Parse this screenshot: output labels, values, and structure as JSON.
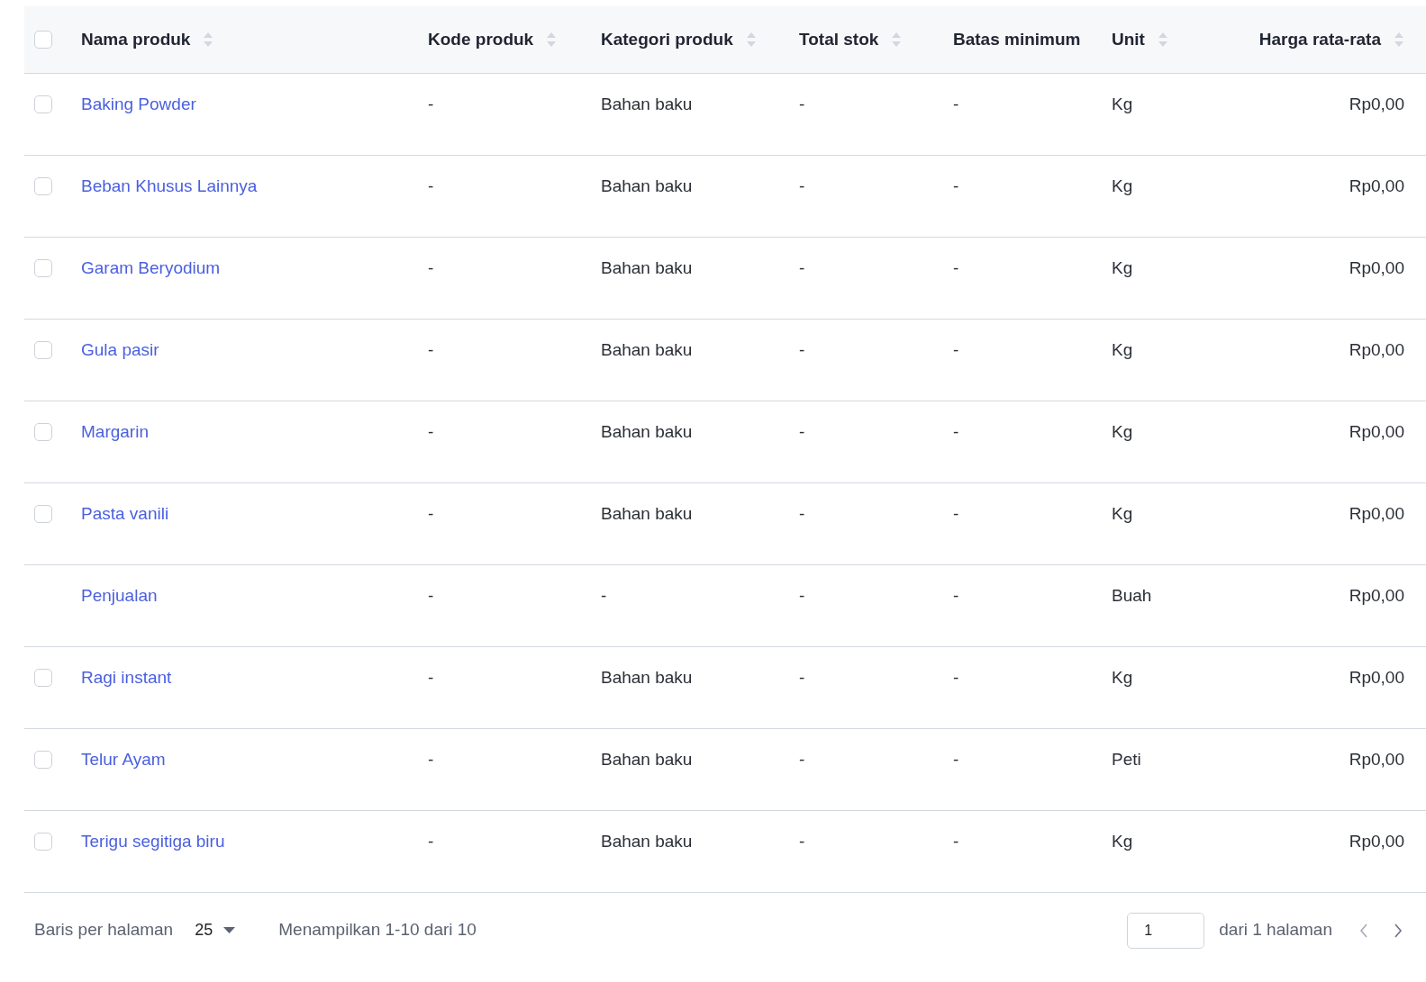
{
  "table": {
    "select_all": {
      "checked": false
    },
    "columns": [
      {
        "label": "Nama produk",
        "sortable": true
      },
      {
        "label": "Kode produk",
        "sortable": true
      },
      {
        "label": "Kategori produk",
        "sortable": true
      },
      {
        "label": "Total stok",
        "sortable": true
      },
      {
        "label": "Batas minimum",
        "sortable": false
      },
      {
        "label": "Unit",
        "sortable": true
      },
      {
        "label": "Harga rata-rata",
        "sortable": true
      }
    ],
    "rows": [
      {
        "kind": "checkbox",
        "checked": false,
        "cells": [
          "Baking Powder",
          "-",
          "Bahan baku",
          "-",
          "-",
          "Kg",
          "Rp0,00"
        ]
      },
      {
        "kind": "checkbox",
        "checked": false,
        "cells": [
          "Beban Khusus Lainnya",
          "-",
          "Bahan baku",
          "-",
          "-",
          "Kg",
          "Rp0,00"
        ]
      },
      {
        "kind": "checkbox",
        "checked": false,
        "cells": [
          "Garam Beryodium",
          "-",
          "Bahan baku",
          "-",
          "-",
          "Kg",
          "Rp0,00"
        ]
      },
      {
        "kind": "checkbox",
        "checked": false,
        "cells": [
          "Gula pasir",
          "-",
          "Bahan baku",
          "-",
          "-",
          "Kg",
          "Rp0,00"
        ]
      },
      {
        "kind": "checkbox",
        "checked": false,
        "cells": [
          "Margarin",
          "-",
          "Bahan baku",
          "-",
          "-",
          "Kg",
          "Rp0,00"
        ]
      },
      {
        "kind": "checkbox",
        "checked": false,
        "cells": [
          "Pasta vanili",
          "-",
          "Bahan baku",
          "-",
          "-",
          "Kg",
          "Rp0,00"
        ]
      },
      {
        "kind": "plain",
        "cells": [
          "Penjualan",
          "-",
          "-",
          "-",
          "-",
          "Buah",
          "Rp0,00"
        ]
      },
      {
        "kind": "checkbox",
        "checked": false,
        "cells": [
          "Ragi instant",
          "-",
          "Bahan baku",
          "-",
          "-",
          "Kg",
          "Rp0,00"
        ]
      },
      {
        "kind": "checkbox",
        "checked": false,
        "cells": [
          "Telur Ayam",
          "-",
          "Bahan baku",
          "-",
          "-",
          "Peti",
          "Rp0,00"
        ]
      },
      {
        "kind": "checkbox",
        "checked": false,
        "cells": [
          "Terigu segitiga biru",
          "-",
          "Bahan baku",
          "-",
          "-",
          "Kg",
          "Rp0,00"
        ]
      }
    ]
  },
  "footer": {
    "rows_per_page_label": "Baris per halaman",
    "rows_per_page": "25",
    "range_text": "Menampilkan 1-10 dari 10",
    "page": "1",
    "page_total_text": "dari 1 halaman",
    "prev_disabled": true,
    "next_disabled": false
  }
}
